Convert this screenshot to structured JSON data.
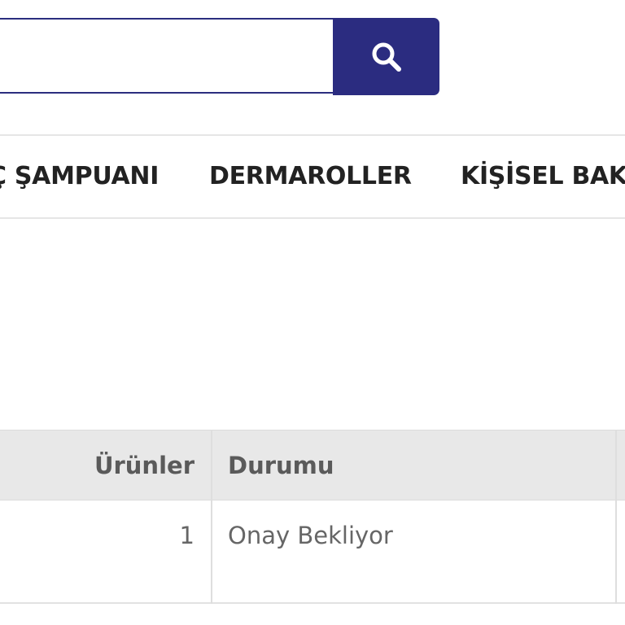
{
  "search": {
    "placeholder": "",
    "value": "",
    "button_icon": "search-icon"
  },
  "nav": {
    "items": [
      {
        "label": "Ç ŞAMPUANI"
      },
      {
        "label": "DERMAROLLER"
      },
      {
        "label": "KİŞİSEL BAK"
      }
    ]
  },
  "table": {
    "headers": {
      "products": "Ürünler",
      "status": "Durumu"
    },
    "rows": [
      {
        "products": "1",
        "status": "Onay Bekliyor"
      }
    ]
  },
  "colors": {
    "accent": "#2b2c80",
    "header_bg": "#e8e8e8",
    "border": "#e2e2e2"
  }
}
